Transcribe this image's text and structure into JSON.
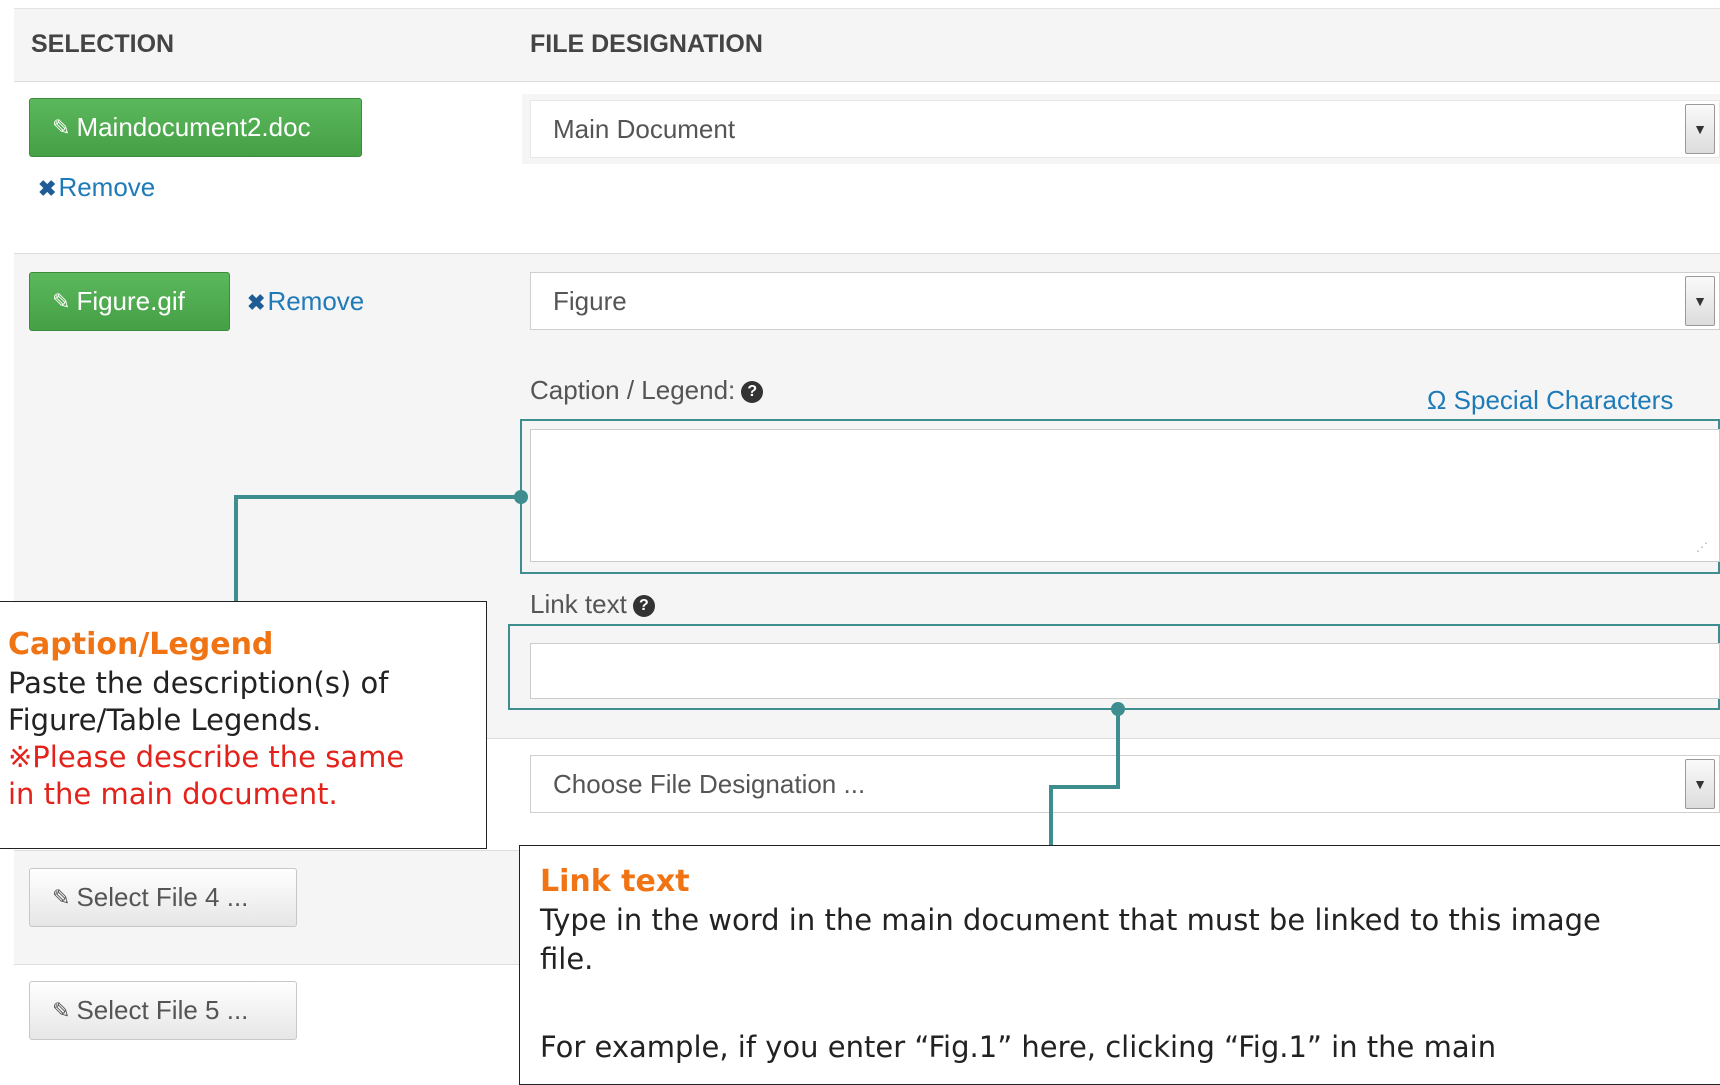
{
  "table": {
    "col_selection": "SELECTION",
    "col_file_designation": "FILE DESIGNATION"
  },
  "rows": [
    {
      "file_button": "Maindocument2.doc",
      "remove_label": "Remove",
      "designation": "Main Document"
    },
    {
      "file_button": "Figure.gif",
      "remove_label": "Remove",
      "designation": "Figure",
      "caption_label": "Caption / Legend:",
      "special_characters": "Ω Special Characters",
      "caption_value": "",
      "link_text_label": "Link text",
      "link_text_value": ""
    },
    {
      "designation": "Choose File Designation ..."
    },
    {
      "file_button": "Select File 4 ..."
    },
    {
      "file_button": "Select File 5 ..."
    }
  ],
  "callouts": {
    "caption": {
      "title": "Caption/Legend",
      "line1": "Paste the description(s) of",
      "line2": "Figure/Table Legends.",
      "note1": "※Please describe the same",
      "note2": "in the main document."
    },
    "link_text": {
      "title": "Link text",
      "line1": "Type in the word in the main document that must be linked to this image",
      "line2": "file.",
      "line3": "For example, if you enter “Fig.1” here, clicking “Fig.1” in the main"
    }
  },
  "colors": {
    "accent_teal": "#3e8e90",
    "button_green": "#5cb85c",
    "link_blue": "#1f7bb8",
    "callout_title_orange": "#f07314",
    "callout_note_red": "#e3231b"
  },
  "icons": [
    "paperclip-icon",
    "remove-x-icon",
    "question-circle-icon",
    "omega-icon",
    "dropdown-arrow-icon"
  ]
}
